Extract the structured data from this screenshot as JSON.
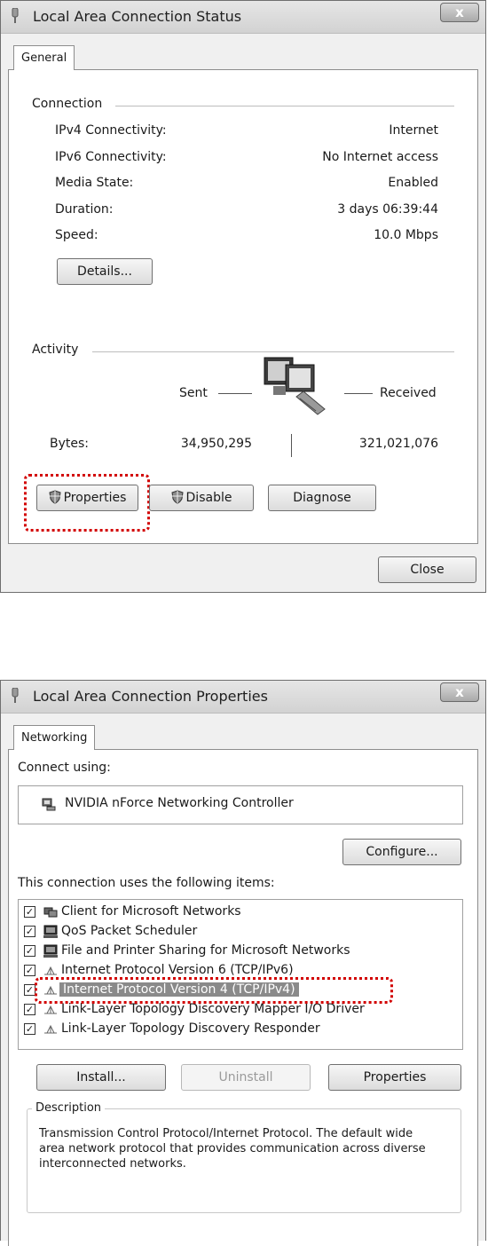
{
  "status_window": {
    "title": "Local Area Connection Status",
    "close_glyph": "x",
    "tab": "General",
    "connection": {
      "group_label": "Connection",
      "rows": [
        {
          "label": "IPv4 Connectivity:",
          "value": "Internet"
        },
        {
          "label": "IPv6 Connectivity:",
          "value": "No Internet access"
        },
        {
          "label": "Media State:",
          "value": "Enabled"
        },
        {
          "label": "Duration:",
          "value": "3 days 06:39:44"
        },
        {
          "label": "Speed:",
          "value": "10.0 Mbps"
        }
      ],
      "details_button": "Details..."
    },
    "activity": {
      "group_label": "Activity",
      "sent_label": "Sent",
      "received_label": "Received",
      "bytes_label": "Bytes:",
      "bytes_sent": "34,950,295",
      "bytes_received": "321,021,076"
    },
    "buttons": {
      "properties": "Properties",
      "disable": "Disable",
      "diagnose": "Diagnose",
      "close": "Close"
    }
  },
  "properties_window": {
    "title": "Local Area Connection Properties",
    "close_glyph": "x",
    "tab": "Networking",
    "connect_using_label": "Connect using:",
    "adapter_name": "NVIDIA nForce Networking Controller",
    "configure_button": "Configure...",
    "items_label": "This connection uses the following items:",
    "items": [
      {
        "label": "Client for Microsoft Networks",
        "checked": true,
        "icon": "network-client-icon"
      },
      {
        "label": "QoS Packet Scheduler",
        "checked": true,
        "icon": "computer-service-icon"
      },
      {
        "label": "File and Printer Sharing for Microsoft Networks",
        "checked": true,
        "icon": "computer-service-icon"
      },
      {
        "label": "Internet Protocol Version 6 (TCP/IPv6)",
        "checked": true,
        "icon": "protocol-icon"
      },
      {
        "label": "Internet Protocol Version 4 (TCP/IPv4)",
        "checked": true,
        "icon": "protocol-icon",
        "selected": true
      },
      {
        "label": "Link-Layer Topology Discovery Mapper I/O Driver",
        "checked": true,
        "icon": "protocol-icon"
      },
      {
        "label": "Link-Layer Topology Discovery Responder",
        "checked": true,
        "icon": "protocol-icon"
      }
    ],
    "install_button": "Install...",
    "uninstall_button": "Uninstall",
    "properties_button": "Properties",
    "description_label": "Description",
    "description_text": "Transmission Control Protocol/Internet Protocol. The default wide area network protocol that provides communication across diverse interconnected networks."
  },
  "colors": {
    "highlight": "#d20000",
    "selection": "#8a8a8a"
  }
}
